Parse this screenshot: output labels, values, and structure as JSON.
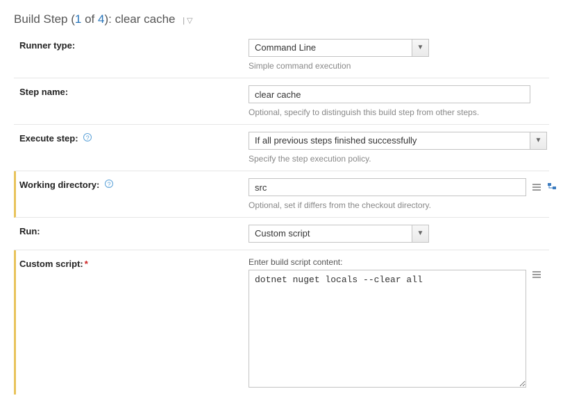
{
  "title": {
    "prefix": "Build Step (",
    "current": "1",
    "of": " of ",
    "total": "4",
    "suffix": "): ",
    "name": "clear cache"
  },
  "runner_type": {
    "label": "Runner type:",
    "value": "Command Line",
    "hint": "Simple command execution"
  },
  "step_name": {
    "label": "Step name:",
    "value": "clear cache",
    "hint": "Optional, specify to distinguish this build step from other steps."
  },
  "execute_step": {
    "label": "Execute step:",
    "value": "If all previous steps finished successfully",
    "hint": "Specify the step execution policy."
  },
  "working_dir": {
    "label": "Working directory:",
    "value": "src",
    "hint": "Optional, set if differs from the checkout directory."
  },
  "run": {
    "label": "Run:",
    "value": "Custom script"
  },
  "custom_script": {
    "label": "Custom script:",
    "above_hint": "Enter build script content:",
    "value": "dotnet nuget locals --clear all"
  }
}
